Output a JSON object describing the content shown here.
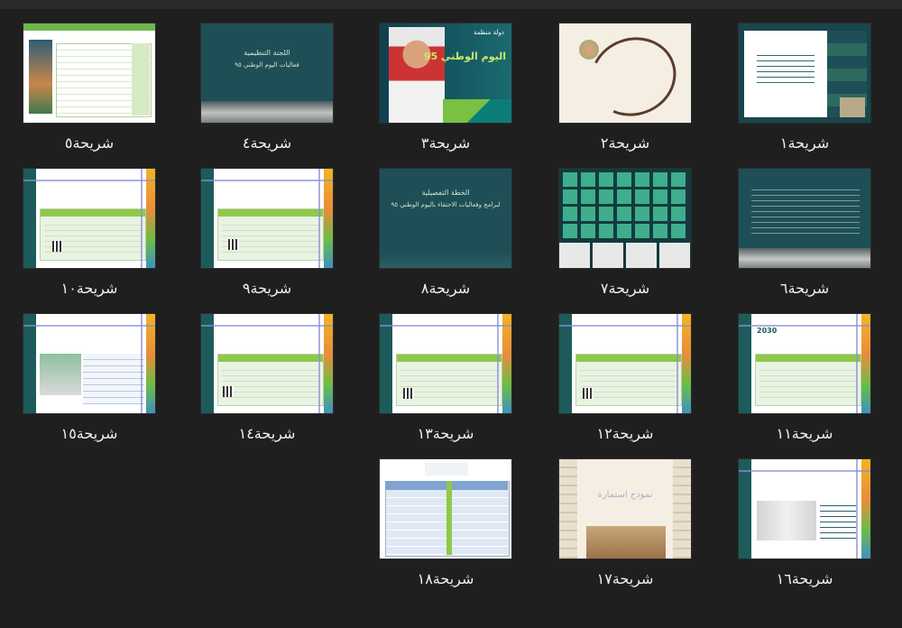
{
  "slides": [
    {
      "label": "شريحة٥"
    },
    {
      "label": "شريحة٤"
    },
    {
      "label": "شريحة٣"
    },
    {
      "label": "شريحة٢"
    },
    {
      "label": "شريحة١"
    },
    {
      "label": "شريحة١٠"
    },
    {
      "label": "شريحة٩"
    },
    {
      "label": "شريحة٨"
    },
    {
      "label": "شريحة٧"
    },
    {
      "label": "شريحة٦"
    },
    {
      "label": "شريحة١٥"
    },
    {
      "label": "شريحة١٤"
    },
    {
      "label": "شريحة١٣"
    },
    {
      "label": "شريحة١٢"
    },
    {
      "label": "شريحة١١"
    },
    {
      "label": "شريحة١٨"
    },
    {
      "label": "شريحة١٧"
    },
    {
      "label": "شريحة١٦"
    }
  ],
  "thumb_text": {
    "s3_title": "اليوم الوطني 95",
    "s3_tag": "دولة منظمة",
    "s4_title": "اللجنة التنظيمية",
    "s4_sub": "فعاليات اليوم الوطني ٩٥",
    "s8_title": "الخطة التفصيلية",
    "s8_sub": "لبرامج وفعاليات الاحتفاء باليوم الوطني ٩٥",
    "s11_vision": "2030",
    "s17_title": "نموذج استمارة"
  },
  "colors": {
    "background": "#1f1f1f",
    "teal": "#1e4f57",
    "green": "#8fc84a"
  }
}
